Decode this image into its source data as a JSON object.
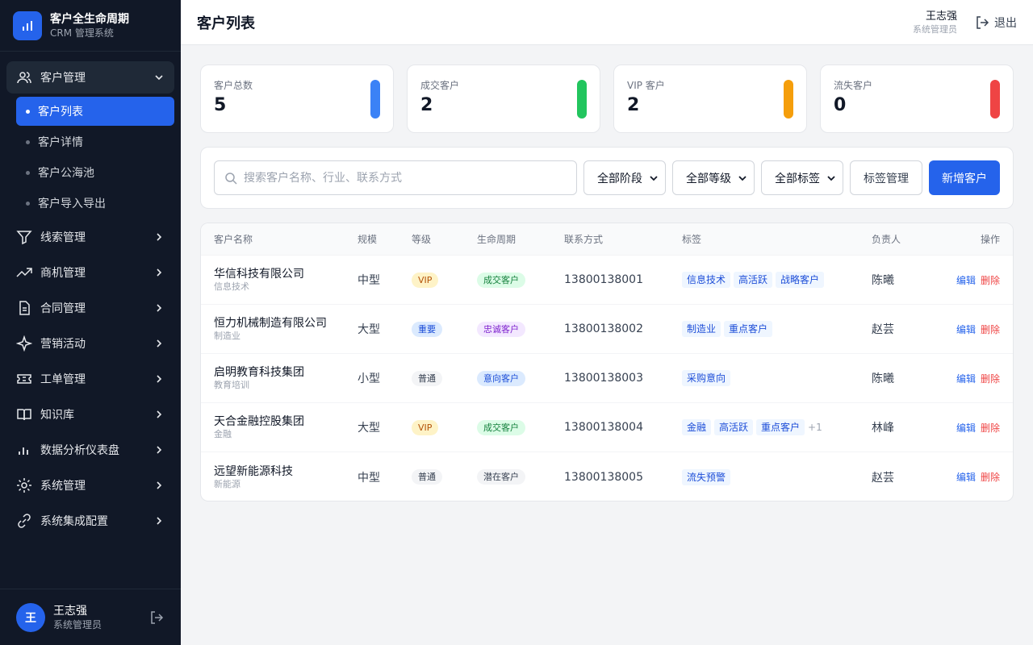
{
  "brand": {
    "title": "客户全生命周期",
    "subtitle": "CRM 管理系统",
    "logo_icon": "bar-chart-icon"
  },
  "sidebar": {
    "items": [
      {
        "label": "客户管理",
        "icon": "users-icon",
        "open": true,
        "children": [
          {
            "label": "客户列表",
            "active": true
          },
          {
            "label": "客户详情"
          },
          {
            "label": "客户公海池"
          },
          {
            "label": "客户导入导出"
          }
        ]
      },
      {
        "label": "线索管理",
        "icon": "filter-icon"
      },
      {
        "label": "商机管理",
        "icon": "trending-up-icon"
      },
      {
        "label": "合同管理",
        "icon": "document-icon"
      },
      {
        "label": "营销活动",
        "icon": "sparkle-icon"
      },
      {
        "label": "工单管理",
        "icon": "ticket-icon"
      },
      {
        "label": "知识库",
        "icon": "book-icon"
      },
      {
        "label": "数据分析仪表盘",
        "icon": "chart-icon"
      },
      {
        "label": "系统管理",
        "icon": "gear-icon"
      },
      {
        "label": "系统集成配置",
        "icon": "link-icon"
      }
    ]
  },
  "footer_user": {
    "avatar": "王",
    "name": "王志强",
    "role": "系统管理员"
  },
  "header": {
    "title": "客户列表",
    "user_name": "王志强",
    "user_role": "系统管理员",
    "logout": "退出"
  },
  "stats": [
    {
      "label": "客户总数",
      "value": "5",
      "color": "#3b82f6"
    },
    {
      "label": "成交客户",
      "value": "2",
      "color": "#22c55e"
    },
    {
      "label": "VIP 客户",
      "value": "2",
      "color": "#f59e0b"
    },
    {
      "label": "流失客户",
      "value": "0",
      "color": "#ef4444"
    }
  ],
  "filters": {
    "search_placeholder": "搜索客户名称、行业、联系方式",
    "stage": "全部阶段",
    "level": "全部等级",
    "tag": "全部标签",
    "tag_manage": "标签管理",
    "new_customer": "新增客户"
  },
  "table": {
    "headers": [
      "客户名称",
      "规模",
      "等级",
      "生命周期",
      "联系方式",
      "标签",
      "负责人",
      "操作"
    ],
    "edit_label": "编辑",
    "delete_label": "删除",
    "rows": [
      {
        "name": "华信科技有限公司",
        "industry": "信息技术",
        "scale": "中型",
        "level": "VIP",
        "level_class": "b-vip",
        "life": "成交客户",
        "life_class": "l-deal",
        "phone": "13800138001",
        "tags": [
          "信息技术",
          "高活跃",
          "战略客户"
        ],
        "more": "",
        "owner": "陈曦"
      },
      {
        "name": "恒力机械制造有限公司",
        "industry": "制造业",
        "scale": "大型",
        "level": "重要",
        "level_class": "b-imp",
        "life": "忠诚客户",
        "life_class": "l-loyal",
        "phone": "13800138002",
        "tags": [
          "制造业",
          "重点客户"
        ],
        "more": "",
        "owner": "赵芸"
      },
      {
        "name": "启明教育科技集团",
        "industry": "教育培训",
        "scale": "小型",
        "level": "普通",
        "level_class": "b-norm",
        "life": "意向客户",
        "life_class": "l-intent",
        "phone": "13800138003",
        "tags": [
          "采购意向"
        ],
        "more": "",
        "owner": "陈曦"
      },
      {
        "name": "天合金融控股集团",
        "industry": "金融",
        "scale": "大型",
        "level": "VIP",
        "level_class": "b-vip",
        "life": "成交客户",
        "life_class": "l-deal",
        "phone": "13800138004",
        "tags": [
          "金融",
          "高活跃",
          "重点客户"
        ],
        "more": "+1",
        "owner": "林峰"
      },
      {
        "name": "远望新能源科技",
        "industry": "新能源",
        "scale": "中型",
        "level": "普通",
        "level_class": "b-norm",
        "life": "潜在客户",
        "life_class": "l-pot",
        "phone": "13800138005",
        "tags": [
          "流失预警"
        ],
        "more": "",
        "owner": "赵芸"
      }
    ]
  }
}
